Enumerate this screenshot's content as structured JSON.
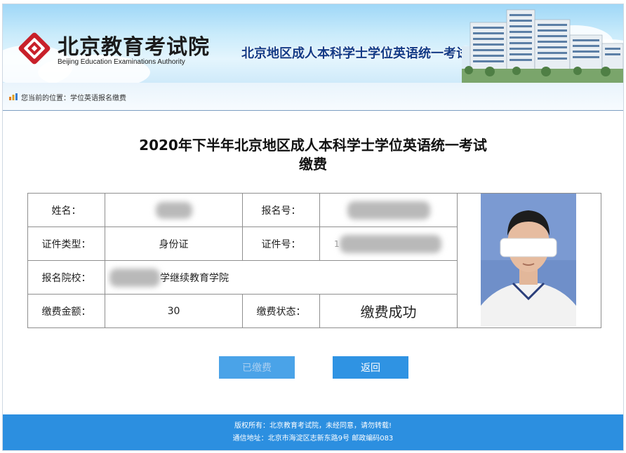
{
  "header": {
    "logo_cn": "北京教育考试院",
    "logo_en": "Beijing Education Examinations Authority",
    "system_title": "北京地区成人本科学士学位英语统一考试缴费",
    "brand_color": "#c8202a"
  },
  "breadcrumb": {
    "text": "您当前的位置：学位英语报名缴费"
  },
  "page": {
    "heading_line1": "2020年下半年北京地区成人本科学士学位英语统一考试",
    "heading_line2": "缴费"
  },
  "info": {
    "name_label": "姓名：",
    "reg_no_label": "报名号：",
    "id_type_label": "证件类型：",
    "id_type_value": "身份证",
    "id_no_label": "证件号：",
    "id_no_prefix": "1",
    "school_label": "报名院校：",
    "school_value": "学继续教育学院",
    "fee_label": "缴费金额：",
    "fee_value": "30",
    "status_label": "缴费状态：",
    "status_value": "缴费成功",
    "status_color": "#e02020"
  },
  "buttons": {
    "paid_label": "已缴费",
    "back_label": "返回",
    "button_color": "#2f93e3"
  },
  "footer": {
    "line1": "版权所有：北京教育考试院，未经同意，请勿转载!",
    "line2": "通信地址：北京市海淀区志新东路9号 邮政编码083"
  }
}
